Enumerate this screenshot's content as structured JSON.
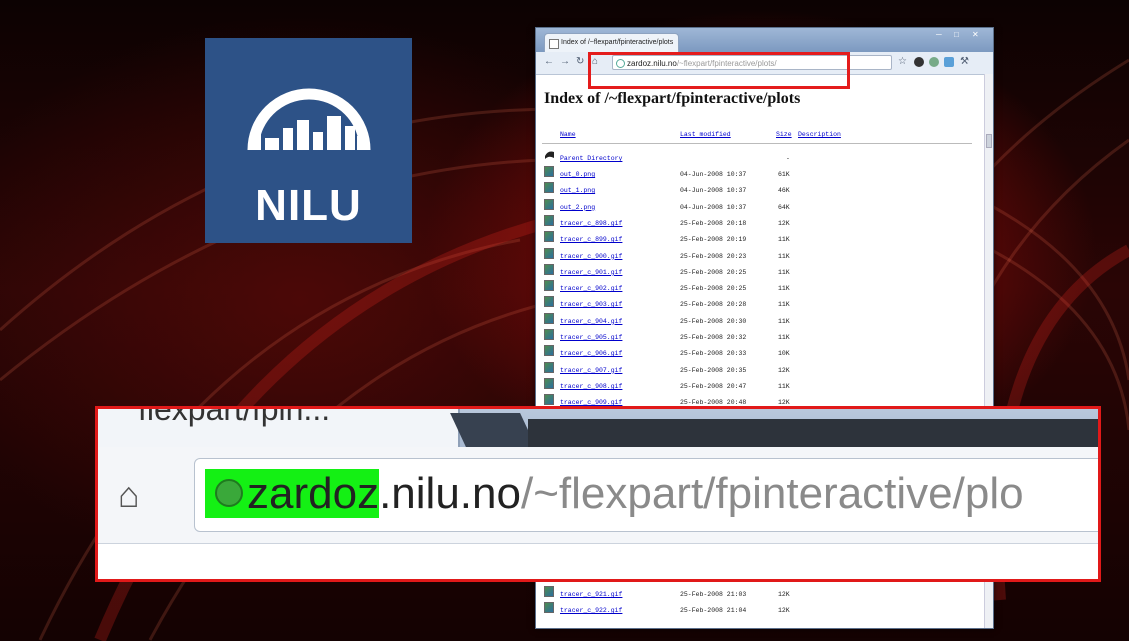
{
  "logo": {
    "text": "NILU",
    "color": "#2d5287"
  },
  "browser": {
    "tab_title": "Index of /~flexpart/fpinteractive/plots",
    "url_host": "zardoz.nilu.no",
    "url_path": "/~flexpart/fpinteractive/plots/",
    "page_heading": "Index of /~flexpart/fpinteractive/plots",
    "columns": {
      "name": "Name",
      "modified": "Last modified",
      "size": "Size",
      "description": "Description"
    },
    "parent": "Parent Directory",
    "parent_size": "-",
    "files": [
      {
        "name": "out_0.png",
        "date": "04-Jun-2008 10:37",
        "size": "61K"
      },
      {
        "name": "out_1.png",
        "date": "04-Jun-2008 10:37",
        "size": "46K"
      },
      {
        "name": "out_2.png",
        "date": "04-Jun-2008 10:37",
        "size": "64K"
      },
      {
        "name": "tracer_c_898.gif",
        "date": "25-Feb-2008 20:18",
        "size": "12K"
      },
      {
        "name": "tracer_c_899.gif",
        "date": "25-Feb-2008 20:19",
        "size": "11K"
      },
      {
        "name": "tracer_c_900.gif",
        "date": "25-Feb-2008 20:23",
        "size": "11K"
      },
      {
        "name": "tracer_c_901.gif",
        "date": "25-Feb-2008 20:25",
        "size": "11K"
      },
      {
        "name": "tracer_c_902.gif",
        "date": "25-Feb-2008 20:25",
        "size": "11K"
      },
      {
        "name": "tracer_c_903.gif",
        "date": "25-Feb-2008 20:28",
        "size": "11K"
      },
      {
        "name": "tracer_c_904.gif",
        "date": "25-Feb-2008 20:30",
        "size": "11K"
      },
      {
        "name": "tracer_c_905.gif",
        "date": "25-Feb-2008 20:32",
        "size": "11K"
      },
      {
        "name": "tracer_c_906.gif",
        "date": "25-Feb-2008 20:33",
        "size": "10K"
      },
      {
        "name": "tracer_c_907.gif",
        "date": "25-Feb-2008 20:35",
        "size": "12K"
      },
      {
        "name": "tracer_c_908.gif",
        "date": "25-Feb-2008 20:47",
        "size": "11K"
      },
      {
        "name": "tracer_c_909.gif",
        "date": "25-Feb-2008 20:48",
        "size": "12K"
      }
    ],
    "bottom_files": [
      {
        "name": "tracer_c_921.gif",
        "date": "25-Feb-2008 21:03",
        "size": "12K"
      },
      {
        "name": "tracer_c_922.gif",
        "date": "25-Feb-2008 21:04",
        "size": "12K"
      }
    ]
  },
  "zoom": {
    "tab_label": "flexpart/fpin...",
    "url_host_highlight": "zardoz",
    "url_host_rest": ".nilu.no",
    "url_path": "/~flexpart/fpinteractive/plo",
    "highlight_color": "#14f014",
    "frame_color": "#e11919"
  }
}
